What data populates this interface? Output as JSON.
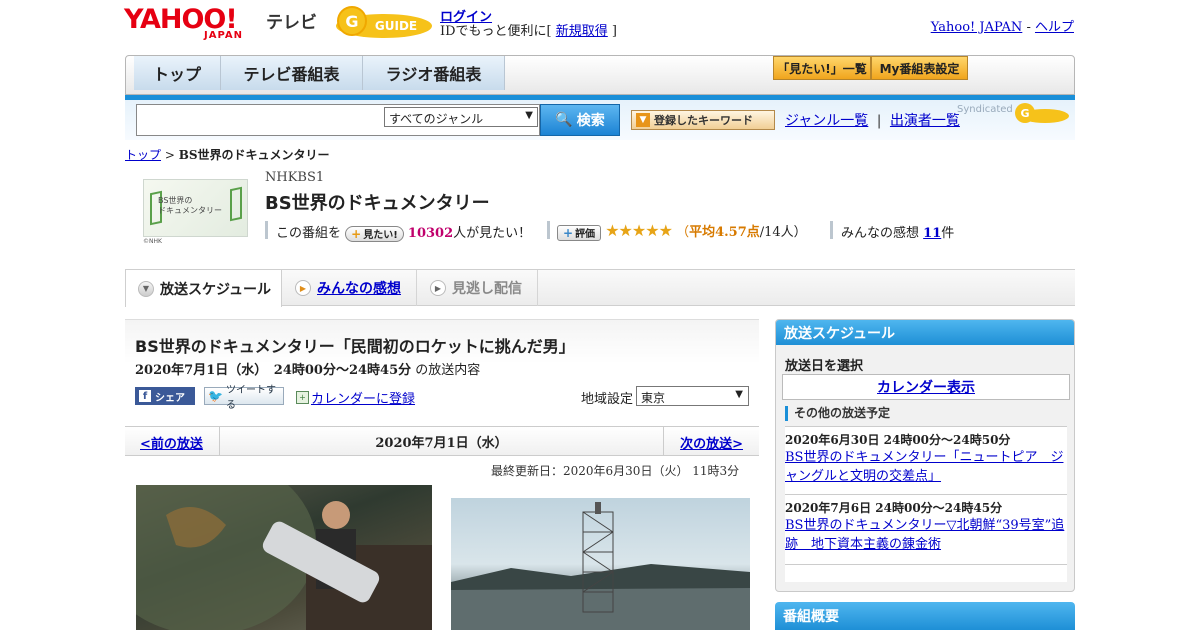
{
  "header": {
    "yahoo_logo": "YAHOO!",
    "japan_label": "JAPAN",
    "tv_label": "テレビ",
    "gguide_logo": "G-GUIDE",
    "login_link": "ログイン",
    "login_prefix": "IDでもっと便利に[ ",
    "signup_link": "新規取得",
    "login_suffix": " ]",
    "yahoo_japan_link": "Yahoo! JAPAN",
    "separator": " - ",
    "help_link": "ヘルプ"
  },
  "nav": {
    "tabs": [
      "トップ",
      "テレビ番組表",
      "ラジオ番組表"
    ],
    "mitai_list": "「見たい!」一覧",
    "my_schedule": "My番組表設定"
  },
  "search": {
    "input_value": "",
    "genre_selected": "すべてのジャンル",
    "search_button": "検索",
    "keyword_button": "登録したキーワード",
    "genre_list_link": "ジャンル一覧",
    "link_sep": "|",
    "performer_link": "出演者一覧",
    "syndicated": "Syndicated"
  },
  "breadcrumb": {
    "top": "トップ",
    "sep": " > ",
    "current": "BS世界のドキュメンタリー"
  },
  "program": {
    "thumb_text_1": "BS世界の",
    "thumb_text_2": "ドキュメンタリー",
    "nhk_mark": "©NHK",
    "channel": "NHKBS1",
    "title": "BS世界のドキュメンタリー",
    "this_program": "この番組を",
    "mitai_button": "見たい!",
    "mitai_count": "10302",
    "mitai_suffix": "人が見たい！",
    "rate_button": "評価",
    "stars": "★★★★★",
    "avg_prefix": "（",
    "avg_value": "平均4.57点",
    "avg_suffix": "/14人）",
    "reviews_label": "みんなの感想",
    "reviews_count": "11",
    "reviews_suffix": "件"
  },
  "tabs": {
    "schedule": "放送スケジュール",
    "reviews": "みんなの感想",
    "vod": "見逃し配信"
  },
  "episode": {
    "title": "BS世界のドキュメンタリー「民間初のロケットに挑んだ男」",
    "date_time": "2020年7月1日（水）　24時00分～24時45分",
    "date_suffix": " の放送内容",
    "fb_share": "シェア",
    "tweet": "ツイートする",
    "calendar_register": "カレンダーに登録",
    "region_label": "地域設定",
    "region_value": "東京",
    "prev": "<前の放送",
    "current_date": "2020年7月1日（水）",
    "next": "次の放送>",
    "updated": "最終更新日：2020年6月30日（火） 11時3分"
  },
  "sidebar": {
    "schedule_head": "放送スケジュール",
    "choose_date": "放送日を選択",
    "calendar_btn": "カレンダー表示",
    "other_label": "その他の放送予定",
    "items": [
      {
        "when": "2020年6月30日 24時00分～24時50分",
        "title": "BS世界のドキュメンタリー「ニュートピア　ジャングルと文明の交差点」"
      },
      {
        "when": "2020年7月6日 24時00分～24時45分",
        "title": "BS世界のドキュメンタリー▽北朝鮮“39号室”追跡　地下資本主義の錬金術"
      }
    ],
    "overview_head": "番組概要"
  },
  "colors": {
    "brand_red": "#e60012",
    "accent_blue": "#1a8fd8",
    "link_blue": "#0000cc",
    "star_orange": "#e7a417",
    "count_pink": "#c0006c"
  }
}
